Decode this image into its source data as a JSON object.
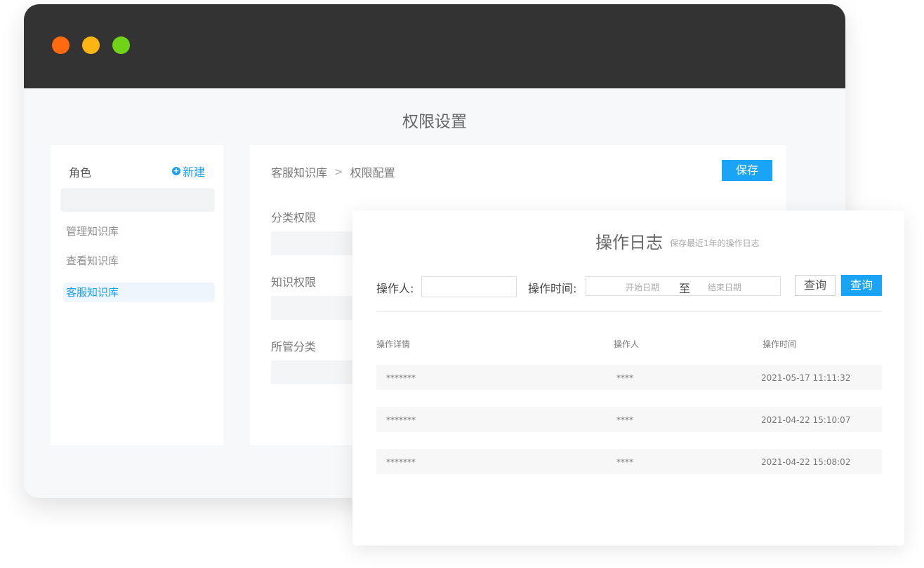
{
  "window": {
    "title": "权限设置"
  },
  "roles": {
    "title": "角色",
    "new_label": "新建",
    "items": [
      {
        "label": "管理知识库"
      },
      {
        "label": "查看知识库"
      },
      {
        "label": "客服知识库",
        "active": true
      }
    ]
  },
  "config": {
    "breadcrumb": [
      "客服知识库",
      "权限配置"
    ],
    "save_label": "保存",
    "sections": [
      "分类权限",
      "知识权限",
      "所管分类"
    ]
  },
  "log": {
    "title": "操作日志",
    "subtitle": "保存最近1年的操作日志",
    "operator_label": "操作人:",
    "time_label": "操作时间:",
    "start_placeholder": "开始日期",
    "to_label": "至",
    "end_placeholder": "结束日期",
    "query_outline_label": "查询",
    "query_primary_label": "查询",
    "columns": [
      "操作详情",
      "操作人",
      "操作时间"
    ],
    "rows": [
      {
        "detail": "*******",
        "operator": "****",
        "time": "2021-05-17 11:11:32"
      },
      {
        "detail": "*******",
        "operator": "****",
        "time": "2021-04-22 15:10:07"
      },
      {
        "detail": "*******",
        "operator": "****",
        "time": "2021-04-22 15:08:02"
      }
    ]
  },
  "colors": {
    "accent": "#1aa4f5",
    "titlebar": "#333333"
  }
}
